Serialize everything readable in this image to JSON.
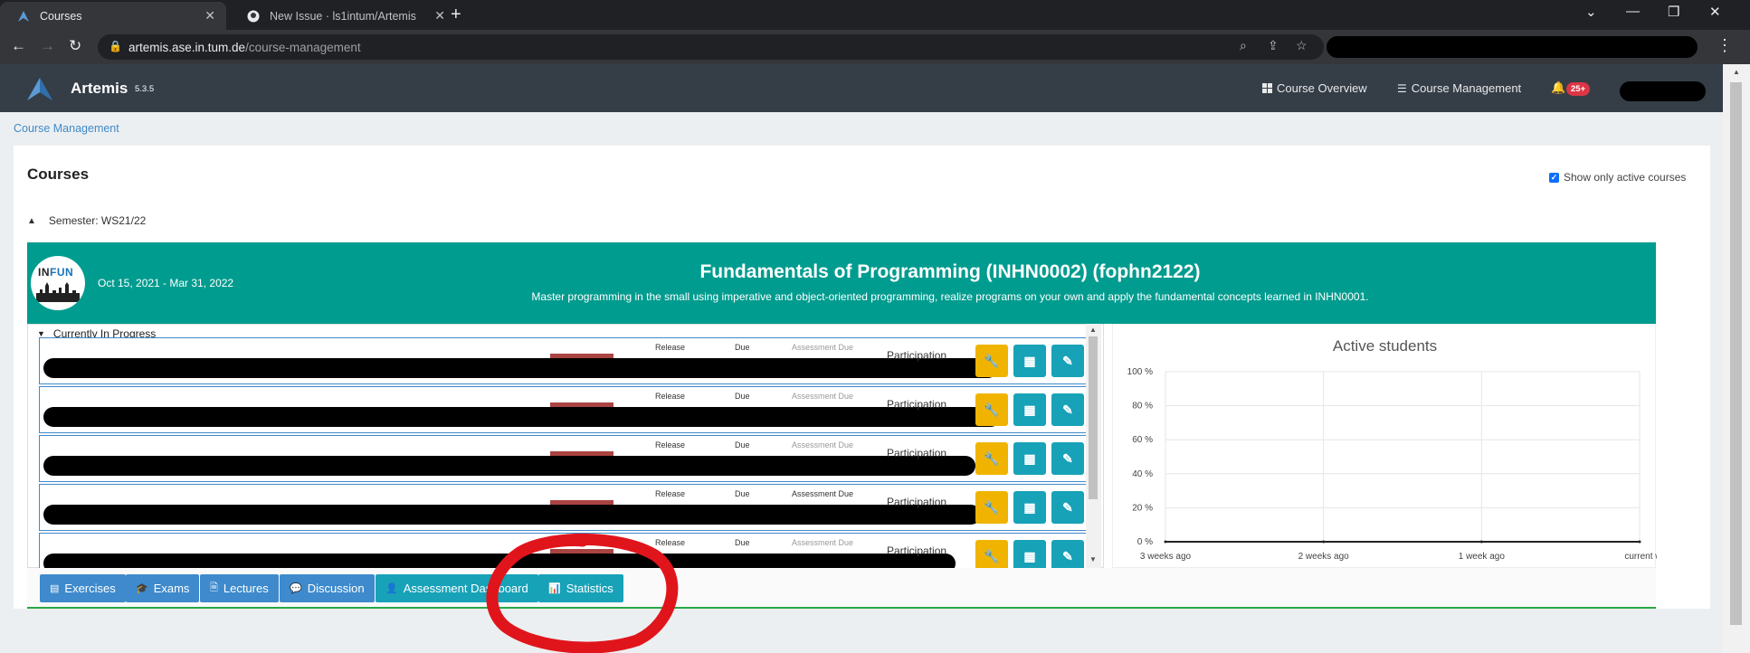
{
  "browser": {
    "tabs": [
      {
        "title": "Courses",
        "active": true
      },
      {
        "title": "New Issue · ls1intum/Artemis",
        "active": false
      }
    ],
    "url_domain": "artemis.ase.in.tum.de",
    "url_path": "/course-management"
  },
  "navbar": {
    "brand": "Artemis",
    "version": "5.3.5",
    "links": [
      "Course Overview",
      "Course Management"
    ],
    "notification_count": "25+"
  },
  "breadcrumb": "Course Management",
  "page": {
    "title": "Courses",
    "active_toggle_label": "Show only active courses",
    "semester_label": "Semester: WS21/22"
  },
  "course": {
    "logo_text_a": "IN",
    "logo_text_b": "FUN",
    "dates": "Oct 15, 2021 - Mar 31, 2022",
    "title": "Fundamentals of Programming (INHN0002) (fophn2122)",
    "description": "Master programming in the small using imperative and object-oriented programming, realize programs on your own and apply the fundamental concepts learned in INHN0001.",
    "accent_color": "#009c8f"
  },
  "exercises": {
    "section_label": "Currently In Progress",
    "col_release": "Release",
    "col_due": "Due",
    "col_assessment_due": "Assessment Due",
    "participation_label": "Participation",
    "row_count": 5
  },
  "chart": {
    "title": "Active students",
    "y_ticks": [
      "100 %",
      "80 %",
      "60 %",
      "40 %",
      "20 %",
      "0 %"
    ],
    "x_ticks": [
      "3 weeks ago",
      "2 weeks ago",
      "1 week ago",
      "current week"
    ]
  },
  "chart_data": {
    "type": "line",
    "title": "Active students",
    "categories": [
      "3 weeks ago",
      "2 weeks ago",
      "1 week ago",
      "current week"
    ],
    "values": [
      0,
      0,
      0,
      0
    ],
    "ylim": [
      0,
      100
    ],
    "yunit": "%",
    "grid": true
  },
  "actions": [
    "Exercises",
    "Exams",
    "Lectures",
    "Discussion",
    "Assessment Dashboard",
    "Statistics"
  ],
  "annotation_color": "#e0151b"
}
